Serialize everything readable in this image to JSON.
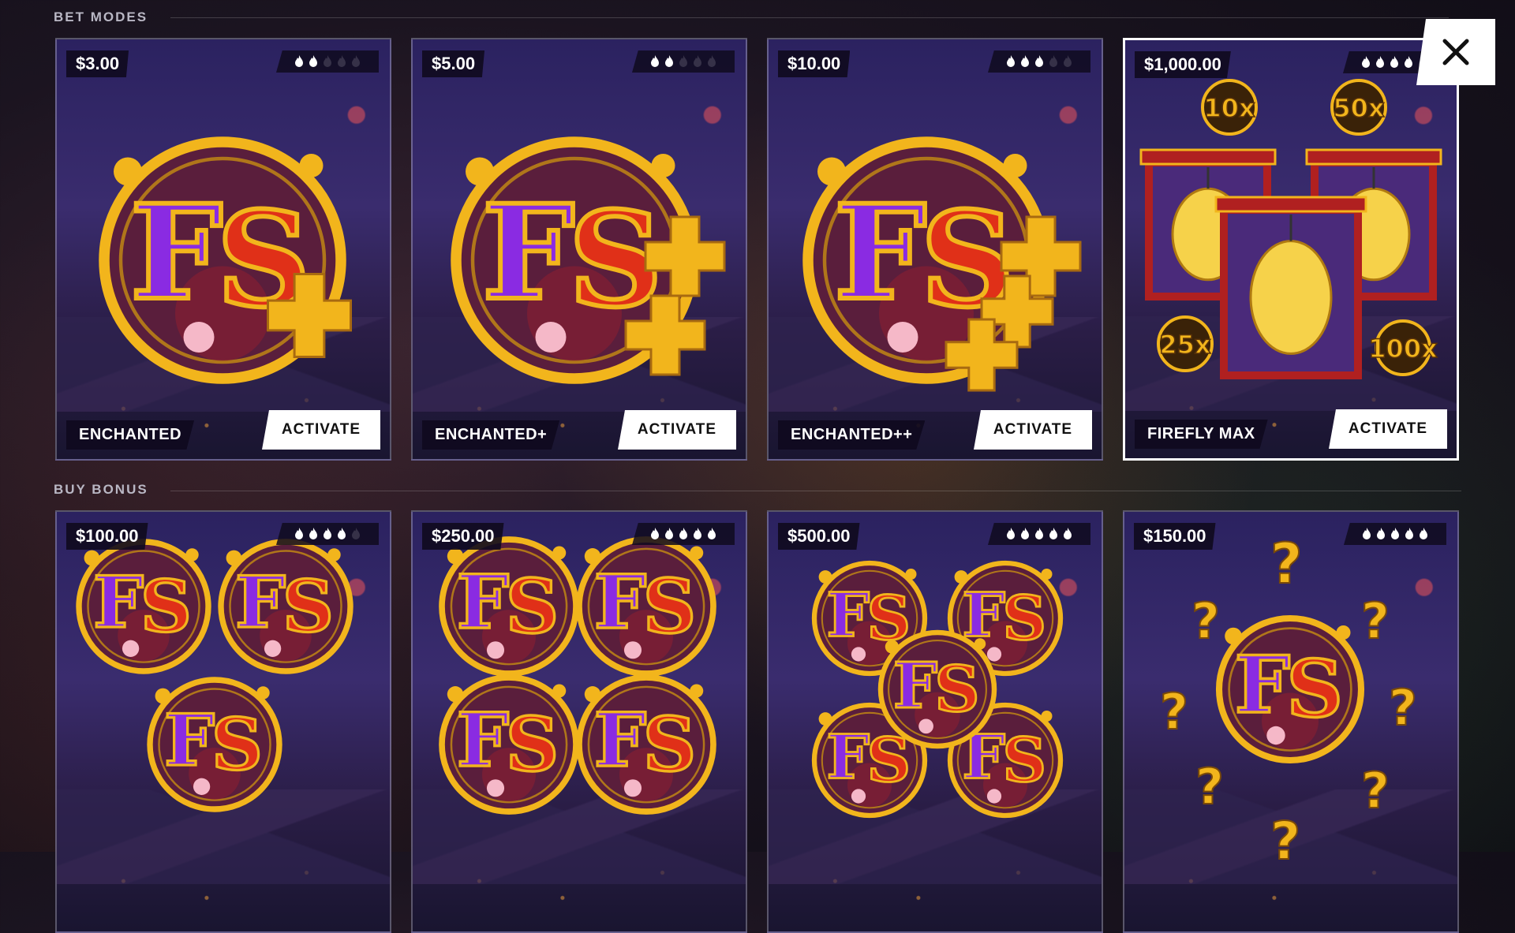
{
  "sections": {
    "bet_modes_label": "BET MODES",
    "buy_bonus_label": "BUY BONUS"
  },
  "close_icon": "close-icon",
  "bet_modes": [
    {
      "price": "$3.00",
      "volatility": 2,
      "name": "ENCHANTED",
      "button": "ACTIVATE",
      "art": "fs-plus-1"
    },
    {
      "price": "$5.00",
      "volatility": 2,
      "name": "ENCHANTED+",
      "button": "ACTIVATE",
      "art": "fs-plus-2"
    },
    {
      "price": "$10.00",
      "volatility": 3,
      "name": "ENCHANTED++",
      "button": "ACTIVATE",
      "art": "fs-plus-3"
    },
    {
      "price": "$1,000.00",
      "volatility": 4,
      "name": "FIREFLY MAX",
      "button": "ACTIVATE",
      "art": "lantern-multipliers",
      "multipliers": [
        "10x",
        "50x",
        "25x",
        "100x"
      ]
    }
  ],
  "buy_bonus": [
    {
      "price": "$100.00",
      "volatility": 4,
      "art": "fs-three"
    },
    {
      "price": "$250.00",
      "volatility": 5,
      "art": "fs-four"
    },
    {
      "price": "$500.00",
      "volatility": 5,
      "art": "fs-five"
    },
    {
      "price": "$150.00",
      "volatility": 5,
      "art": "fs-mystery"
    }
  ],
  "colors": {
    "accent_purple": "#8a2be2",
    "accent_red": "#e03018",
    "gold": "#f2b51c",
    "card_bg": "#2b2260"
  }
}
